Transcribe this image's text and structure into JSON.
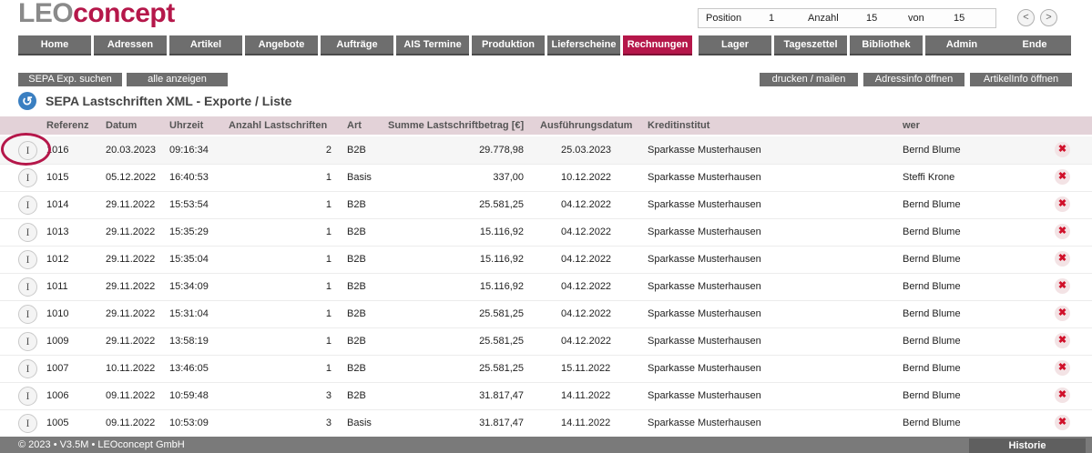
{
  "app": {
    "logo_part1": "LEO",
    "logo_part2": "concept"
  },
  "position": {
    "label": "Position",
    "value": "1",
    "count_label": "Anzahl",
    "count": "15",
    "of_label": "von",
    "of": "15"
  },
  "nav": {
    "prev": "<",
    "next": ">"
  },
  "menu": [
    "Home",
    "Adressen",
    "Artikel",
    "Angebote",
    "Aufträge",
    "AIS Termine",
    "Produktion",
    "Lieferscheine",
    "Rechnungen",
    "Lager",
    "Tageszettel",
    "Bibliothek",
    "Admin",
    "Ende"
  ],
  "menu_active": "Rechnungen",
  "toolbar": {
    "search": "SEPA Exp. suchen",
    "show_all": "alle anzeigen",
    "print": "drucken / mailen",
    "addr": "Adressinfo öffnen",
    "article": "ArtikelInfo öffnen"
  },
  "page": {
    "title": "SEPA Lastschriften XML - Exporte / Liste"
  },
  "table": {
    "headers": {
      "ref": "Referenz",
      "date": "Datum",
      "time": "Uhrzeit",
      "count": "Anzahl Lastschriften",
      "type": "Art",
      "sum": "Summe Lastschriftbetrag [€]",
      "exec": "Ausführungsdatum",
      "bank": "Kreditinstitut",
      "who": "wer"
    },
    "rows": [
      {
        "ref": "1016",
        "date": "20.03.2023",
        "time": "09:16:34",
        "count": "2",
        "type": "B2B",
        "sum": "29.778,98",
        "exec": "25.03.2023",
        "bank": "Sparkasse Musterhausen",
        "who": "Bernd Blume"
      },
      {
        "ref": "1015",
        "date": "05.12.2022",
        "time": "16:40:53",
        "count": "1",
        "type": "Basis",
        "sum": "337,00",
        "exec": "10.12.2022",
        "bank": "Sparkasse Musterhausen",
        "who": "Steffi Krone"
      },
      {
        "ref": "1014",
        "date": "29.11.2022",
        "time": "15:53:54",
        "count": "1",
        "type": "B2B",
        "sum": "25.581,25",
        "exec": "04.12.2022",
        "bank": "Sparkasse Musterhausen",
        "who": "Bernd Blume"
      },
      {
        "ref": "1013",
        "date": "29.11.2022",
        "time": "15:35:29",
        "count": "1",
        "type": "B2B",
        "sum": "15.116,92",
        "exec": "04.12.2022",
        "bank": "Sparkasse Musterhausen",
        "who": "Bernd Blume"
      },
      {
        "ref": "1012",
        "date": "29.11.2022",
        "time": "15:35:04",
        "count": "1",
        "type": "B2B",
        "sum": "15.116,92",
        "exec": "04.12.2022",
        "bank": "Sparkasse Musterhausen",
        "who": "Bernd Blume"
      },
      {
        "ref": "1011",
        "date": "29.11.2022",
        "time": "15:34:09",
        "count": "1",
        "type": "B2B",
        "sum": "15.116,92",
        "exec": "04.12.2022",
        "bank": "Sparkasse Musterhausen",
        "who": "Bernd Blume"
      },
      {
        "ref": "1010",
        "date": "29.11.2022",
        "time": "15:31:04",
        "count": "1",
        "type": "B2B",
        "sum": "25.581,25",
        "exec": "04.12.2022",
        "bank": "Sparkasse Musterhausen",
        "who": "Bernd Blume"
      },
      {
        "ref": "1009",
        "date": "29.11.2022",
        "time": "13:58:19",
        "count": "1",
        "type": "B2B",
        "sum": "25.581,25",
        "exec": "04.12.2022",
        "bank": "Sparkasse Musterhausen",
        "who": "Bernd Blume"
      },
      {
        "ref": "1007",
        "date": "10.11.2022",
        "time": "13:46:05",
        "count": "1",
        "type": "B2B",
        "sum": "25.581,25",
        "exec": "15.11.2022",
        "bank": "Sparkasse Musterhausen",
        "who": "Bernd Blume"
      },
      {
        "ref": "1006",
        "date": "09.11.2022",
        "time": "10:59:48",
        "count": "3",
        "type": "B2B",
        "sum": "31.817,47",
        "exec": "14.11.2022",
        "bank": "Sparkasse Musterhausen",
        "who": "Bernd Blume"
      },
      {
        "ref": "1005",
        "date": "09.11.2022",
        "time": "10:53:09",
        "count": "3",
        "type": "Basis",
        "sum": "31.817,47",
        "exec": "14.11.2022",
        "bank": "Sparkasse Musterhausen",
        "who": "Bernd Blume"
      }
    ],
    "info_glyph": "I",
    "delete_glyph": "✖"
  },
  "footer": {
    "copyright": "© 2023 • V3.5M • LEOconcept GmbH",
    "history": "Historie"
  },
  "colors": {
    "brand": "#b5174a",
    "menu": "#6e6e6e",
    "header_row": "#e3d2d8"
  },
  "icons": {
    "back": "back-arrow-icon",
    "info": "info-icon",
    "delete": "delete-icon"
  }
}
